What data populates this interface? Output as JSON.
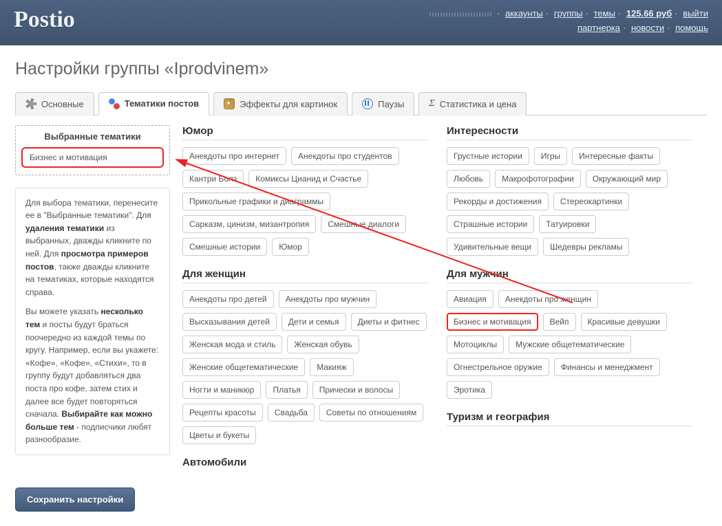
{
  "brand": "Postio",
  "topnav": {
    "line1": [
      "аккаунты",
      "группы",
      "темы"
    ],
    "balance": "125.66 руб",
    "logout": "выйти",
    "line2": [
      "партнерка",
      "новости",
      "помощь"
    ]
  },
  "page_title": "Настройки группы «Iprodvinem»",
  "tabs": [
    {
      "id": "main",
      "label": "Основные",
      "active": false
    },
    {
      "id": "themes",
      "label": "Тематики постов",
      "active": true
    },
    {
      "id": "fx",
      "label": "Эффекты для картинок",
      "active": false
    },
    {
      "id": "pause",
      "label": "Паузы",
      "active": false
    },
    {
      "id": "stats",
      "label": "Статистика и цена",
      "active": false
    }
  ],
  "selected": {
    "title": "Выбранные тематики",
    "items": [
      "Бизнес и мотивация"
    ]
  },
  "help": {
    "p1_a": "Для выбора тематики, перенесите ее в \"Выбранные тематики\". Для ",
    "p1_b": "удаления тематики",
    "p1_c": " из выбранных, дважды кликните по ней. Для ",
    "p1_d": "просмотра примеров постов",
    "p1_e": ", также дважды кликните на тематиках, которые находятся справа.",
    "p2_a": "Вы можете указать ",
    "p2_b": "несколько тем",
    "p2_c": " и посты будут браться поочередно из каждой темы по кругу. Например, если вы укажете: «Кофе», «Кофе», «Стихи», то в группу будут добавляться два поста про кофе, затем стих и далее все будет повторяться сначала. ",
    "p2_d": "Выбирайте как можно больше тем",
    "p2_e": " - подписчики любят разнообразие."
  },
  "categories_left": [
    {
      "title": "Юмор",
      "tags": [
        "Анекдоты про интернет",
        "Анекдоты про студентов",
        "Кантри Болз",
        "Комиксы Цианид и Счастье",
        "Прикольные графики и диаграммы",
        "Сарказм, цинизм, мизантропия",
        "Смешные диалоги",
        "Смешные истории",
        "Юмор"
      ]
    },
    {
      "title": "Для женщин",
      "tags": [
        "Анекдоты про детей",
        "Анекдоты про мужчин",
        "Высказывания детей",
        "Дети и семья",
        "Диеты и фитнес",
        "Женская мода и стиль",
        "Женская обувь",
        "Женские общетематические",
        "Макияж",
        "Ногти и маникюр",
        "Платья",
        "Прически и волосы",
        "Рецепты красоты",
        "Свадьба",
        "Советы по отношениям",
        "Цветы и букеты"
      ]
    },
    {
      "title": "Автомобили",
      "tags": []
    }
  ],
  "categories_right": [
    {
      "title": "Интересности",
      "tags": [
        "Грустные истории",
        "Игры",
        "Интересные факты",
        "Любовь",
        "Макрофотографии",
        "Окружающий мир",
        "Рекорды и достижения",
        "Стереокартинки",
        "Страшные истории",
        "Татуировки",
        "Удивительные вещи",
        "Шедевры рекламы"
      ]
    },
    {
      "title": "Для мужчин",
      "tags": [
        "Авиация",
        "Анекдоты про женщин",
        {
          "t": "Бизнес и мотивация",
          "hl": true
        },
        "Вейп",
        "Красивые девушки",
        "Мотоциклы",
        "Мужские общетематические",
        "Огнестрельное оружие",
        "Финансы и менеджмент",
        "Эротика"
      ]
    },
    {
      "title": "Туризм и география",
      "tags": []
    }
  ],
  "save_button": "Сохранить настройки"
}
